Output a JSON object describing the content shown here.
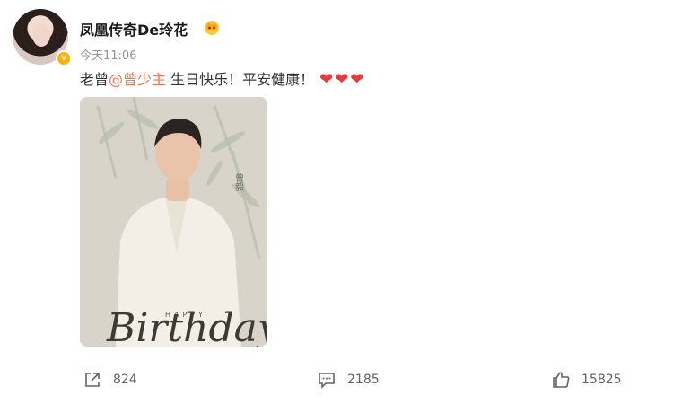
{
  "post": {
    "username": "凤凰传奇De玲花",
    "time": "今天11:06",
    "content_prefix": "老曾",
    "mention": "@曾少主",
    "content_suffix": " 生日快乐！平安健康！",
    "hearts": "❤❤❤"
  },
  "image": {
    "name_text": "曾毅",
    "happy_text": "HAPPY",
    "birthday_text": "Birthday"
  },
  "actions": {
    "share_count": "824",
    "comment_count": "2185",
    "like_count": "15825"
  },
  "colors": {
    "mention": "#eb7350",
    "heart": "#e43b3b",
    "verify": "#ffb000"
  }
}
